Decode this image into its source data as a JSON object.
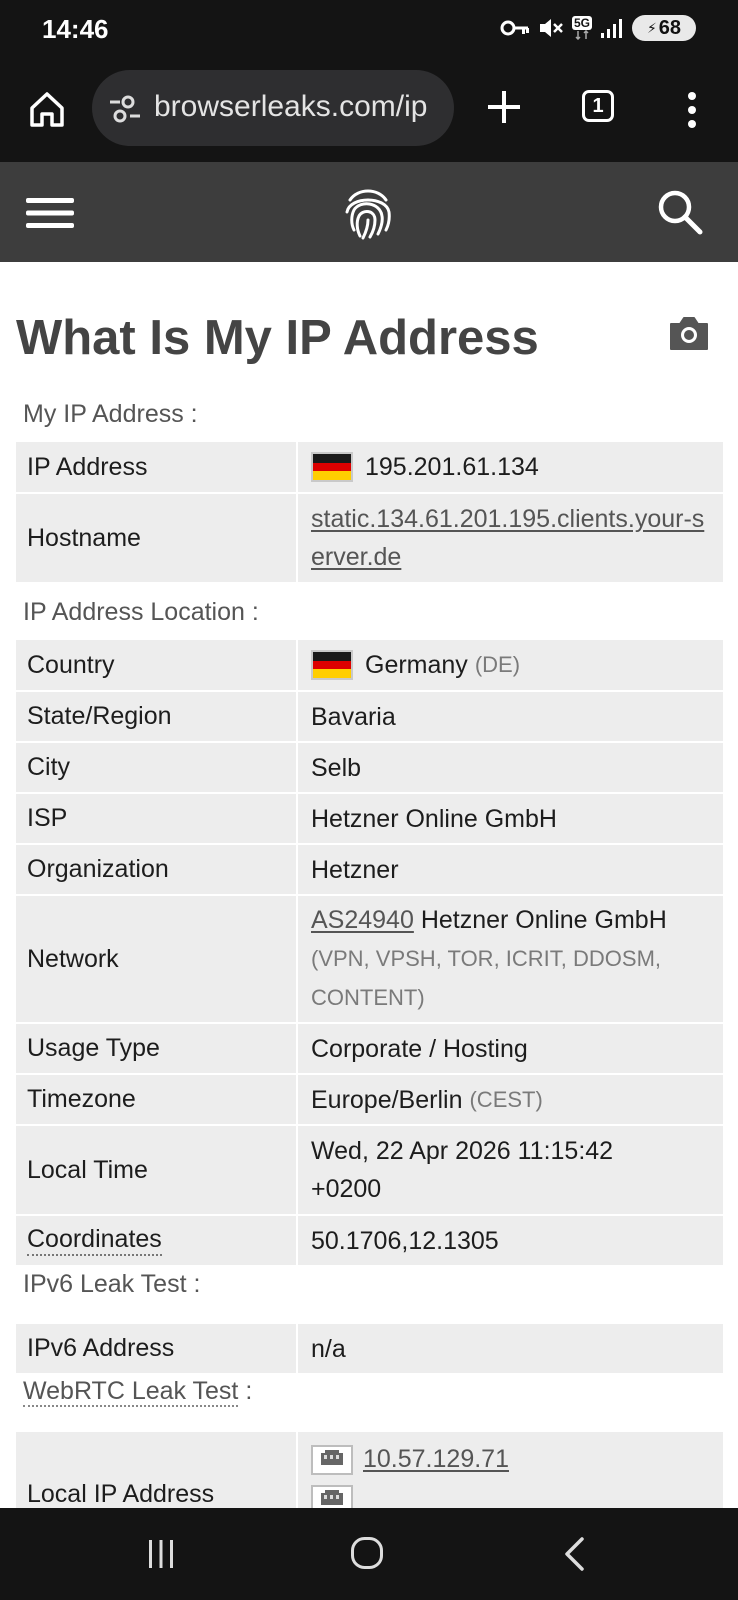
{
  "status_bar": {
    "time": "14:46",
    "network": "5G",
    "battery": "68",
    "icons": [
      "vpn-key-icon",
      "mute-icon",
      "5g-icon",
      "signal-icon",
      "battery-icon"
    ]
  },
  "browser": {
    "url": "browserleaks.com/ip",
    "tab_count": "1",
    "icons": [
      "home-icon",
      "site-settings-icon",
      "new-tab-icon",
      "tabs-icon",
      "more-menu-icon"
    ]
  },
  "site_header": {
    "icons": [
      "hamburger-menu-icon",
      "fingerprint-logo-icon",
      "search-icon"
    ]
  },
  "page": {
    "title": "What Is My IP Address",
    "title_icon": "camera-icon"
  },
  "sections": {
    "my_ip": {
      "label": "My IP Address :",
      "rows": {
        "ip_address": {
          "key": "IP Address",
          "value": "195.201.61.134"
        },
        "hostname": {
          "key": "Hostname",
          "value": "static.134.61.201.195.clients.your-server.de"
        }
      }
    },
    "location": {
      "label": "IP Address Location :",
      "rows": {
        "country": {
          "key": "Country",
          "value": "Germany",
          "code": "(DE)"
        },
        "state": {
          "key": "State/Region",
          "value": "Bavaria"
        },
        "city": {
          "key": "City",
          "value": "Selb"
        },
        "isp": {
          "key": "ISP",
          "value": "Hetzner Online GmbH"
        },
        "organization": {
          "key": "Organization",
          "value": "Hetzner"
        },
        "network": {
          "key": "Network",
          "asn": "AS24940",
          "value": "Hetzner Online GmbH",
          "tags": "(VPN, VPSH, TOR, ICRIT, DDOSM, CONTENT)"
        },
        "usage_type": {
          "key": "Usage Type",
          "value": "Corporate / Hosting"
        },
        "timezone": {
          "key": "Timezone",
          "value": "Europe/Berlin",
          "abbr": "(CEST)"
        },
        "local_time": {
          "key": "Local Time",
          "value": "Wed, 22 Apr 2026 11:15:42 +0200"
        },
        "coordinates": {
          "key": "Coordinates",
          "value": "50.1706,12.1305"
        }
      }
    },
    "ipv6": {
      "label": "IPv6 Leak Test",
      "label_suffix": ":",
      "rows": {
        "ipv6_address": {
          "key": "IPv6 Address",
          "value": "n/a"
        }
      }
    },
    "webrtc": {
      "label": "WebRTC Leak Test",
      "label_suffix": ":",
      "rows": {
        "local_ip": {
          "key": "Local IP Address",
          "value": "10.57.129.71"
        }
      }
    }
  },
  "colors": {
    "header_bg": "#3d3d3d",
    "status_bg": "#141414",
    "row_bg": "#ededed",
    "flag_de": [
      "#1a1a1a",
      "#dd0000",
      "#ffce00"
    ]
  },
  "nav_bar": {
    "icons": [
      "recent-apps-icon",
      "home-nav-icon",
      "back-icon"
    ]
  }
}
